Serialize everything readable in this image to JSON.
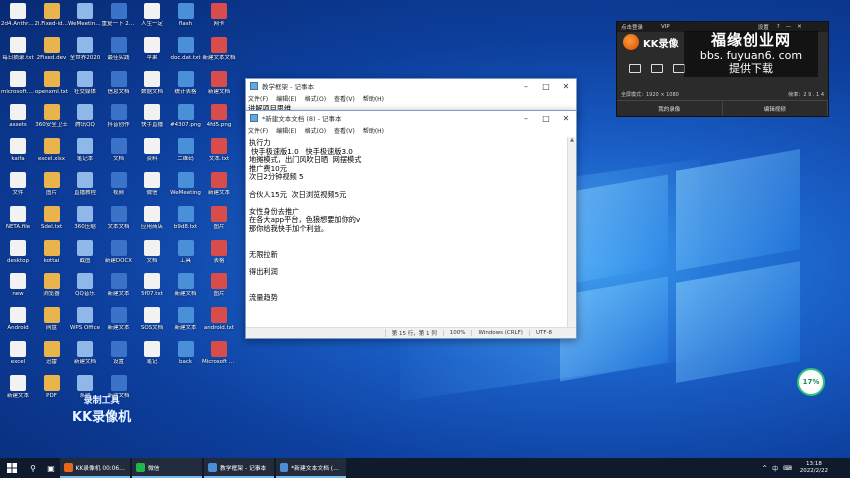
{
  "desktop": {
    "icons": [
      {
        "label": "2d4.Anthro..."
      },
      {
        "label": "2l.Fixed-ide..."
      },
      {
        "label": "WeMeeting微信"
      },
      {
        "label": "重复一下 2022/2"
      },
      {
        "label": "人生一定"
      },
      {
        "label": "flash"
      },
      {
        "label": "网卡"
      },
      {
        "label": "每日摘录.txt"
      },
      {
        "label": "2Fixed.dev"
      },
      {
        "label": "全世界2020"
      },
      {
        "label": "最佳实践"
      },
      {
        "label": "苹果"
      },
      {
        "label": "doc.dat.txt"
      },
      {
        "label": "新建文本文档"
      },
      {
        "label": "microsoft.txt"
      },
      {
        "label": "openxml.txt"
      },
      {
        "label": "社交媒体"
      },
      {
        "label": "信息文档"
      },
      {
        "label": "数据文档"
      },
      {
        "label": "统计表格"
      },
      {
        "label": "新建文档"
      },
      {
        "label": "assets"
      },
      {
        "label": "360安全卫士"
      },
      {
        "label": "腾讯QQ"
      },
      {
        "label": "抖音创作"
      },
      {
        "label": "快手直播"
      },
      {
        "label": "#4307.png"
      },
      {
        "label": "4fd5.png"
      },
      {
        "label": "kaifa"
      },
      {
        "label": "excel.xlsx"
      },
      {
        "label": "笔记本"
      },
      {
        "label": "文档"
      },
      {
        "label": "资料"
      },
      {
        "label": "二维码"
      },
      {
        "label": "文本.txt"
      },
      {
        "label": "文件"
      },
      {
        "label": "图片"
      },
      {
        "label": "直播教程"
      },
      {
        "label": "视频"
      },
      {
        "label": "微信"
      },
      {
        "label": "WeMeeting"
      },
      {
        "label": "新建文本"
      },
      {
        "label": "NETA.file"
      },
      {
        "label": "Sdel.txt"
      },
      {
        "label": "360压缩"
      },
      {
        "label": "文本文档"
      },
      {
        "label": "应用商店"
      },
      {
        "label": "b9d8.txt"
      },
      {
        "label": "图片"
      },
      {
        "label": "desktop"
      },
      {
        "label": "kottai"
      },
      {
        "label": "截图"
      },
      {
        "label": "新建DOCX"
      },
      {
        "label": "文档"
      },
      {
        "label": "工具"
      },
      {
        "label": "表格"
      },
      {
        "label": "new"
      },
      {
        "label": "浏览器"
      },
      {
        "label": "QQ音乐"
      },
      {
        "label": "新建文本"
      },
      {
        "label": "5f07.txt"
      },
      {
        "label": "新建文档"
      },
      {
        "label": "图片"
      },
      {
        "label": "Android"
      },
      {
        "label": "网盘"
      },
      {
        "label": "WPS Office"
      },
      {
        "label": "新建文本"
      },
      {
        "label": "SOS文档"
      },
      {
        "label": "新建文本"
      },
      {
        "label": "android.txt"
      },
      {
        "label": "excel"
      },
      {
        "label": "迅雷"
      },
      {
        "label": "新建文档"
      },
      {
        "label": "设置"
      },
      {
        "label": "笔记"
      },
      {
        "label": "back"
      },
      {
        "label": "Microsoft Edge"
      },
      {
        "label": "新建文本"
      },
      {
        "label": "PDF"
      },
      {
        "label": "系统"
      },
      {
        "label": "新建文档"
      }
    ]
  },
  "notepad_back": {
    "title": "教学框架 - 记事本",
    "menu": [
      "文件(F)",
      "编辑(E)",
      "格式(O)",
      "查看(V)",
      "帮助(H)"
    ],
    "text": "讲解项目思维"
  },
  "notepad_front": {
    "title": "*新建文本文档 (8) - 记事本",
    "menu": [
      "文件(F)",
      "编辑(E)",
      "格式(O)",
      "查看(V)",
      "帮助(H)"
    ],
    "text": "执行力\n 快手极速版1.0   快手极速版3.0\n地摊模式，出门风吹日晒  网摆模式\n推广费10元\n次日2分钟视频 5\n\n合伙人15元  次日浏览视频5元\n\n女性身份去推广\n在各大app平台，色狼想要加你的v\n那你给我快手加个利益。\n\n\n无限拉新\n\n得出利润\n\n\n流量趋势",
    "status": {
      "position": "第 15 行，第 1 列",
      "zoom": "100%",
      "eol": "Windows (CRLF)",
      "encoding": "UTF-8"
    }
  },
  "kk_panel": {
    "top": [
      "点击登录",
      "VIP",
      "设置",
      "?",
      "—",
      "✕"
    ],
    "logo": "KK录像",
    "fullscreen": "全屏模式：1920 × 1080",
    "fps": "帧率：2 9 . 1 4",
    "btn_left": "我的录像",
    "btn_right": "编辑视频",
    "watermark": {
      "line1": "福缘创业网",
      "line2": "bbs. fuyuan6. com",
      "line3": "提供下载"
    }
  },
  "kk_watermark": {
    "line1": "录制工具",
    "line2": "KK录像机"
  },
  "badge": {
    "value": "17%",
    "sub": "×"
  },
  "taskbar": {
    "apps": [
      {
        "label": "KK录像机 00:06:41",
        "color": "#e8671b"
      },
      {
        "label": "微信",
        "color": "#21b54c"
      },
      {
        "label": "教学框架 - 记事本",
        "color": "#4d8dd6"
      },
      {
        "label": "*新建文本文档 (8) ...",
        "color": "#4d8dd6"
      }
    ],
    "tray": [
      "^",
      "中",
      "⌨"
    ],
    "time": "13:18",
    "date": "2022/2/22"
  }
}
